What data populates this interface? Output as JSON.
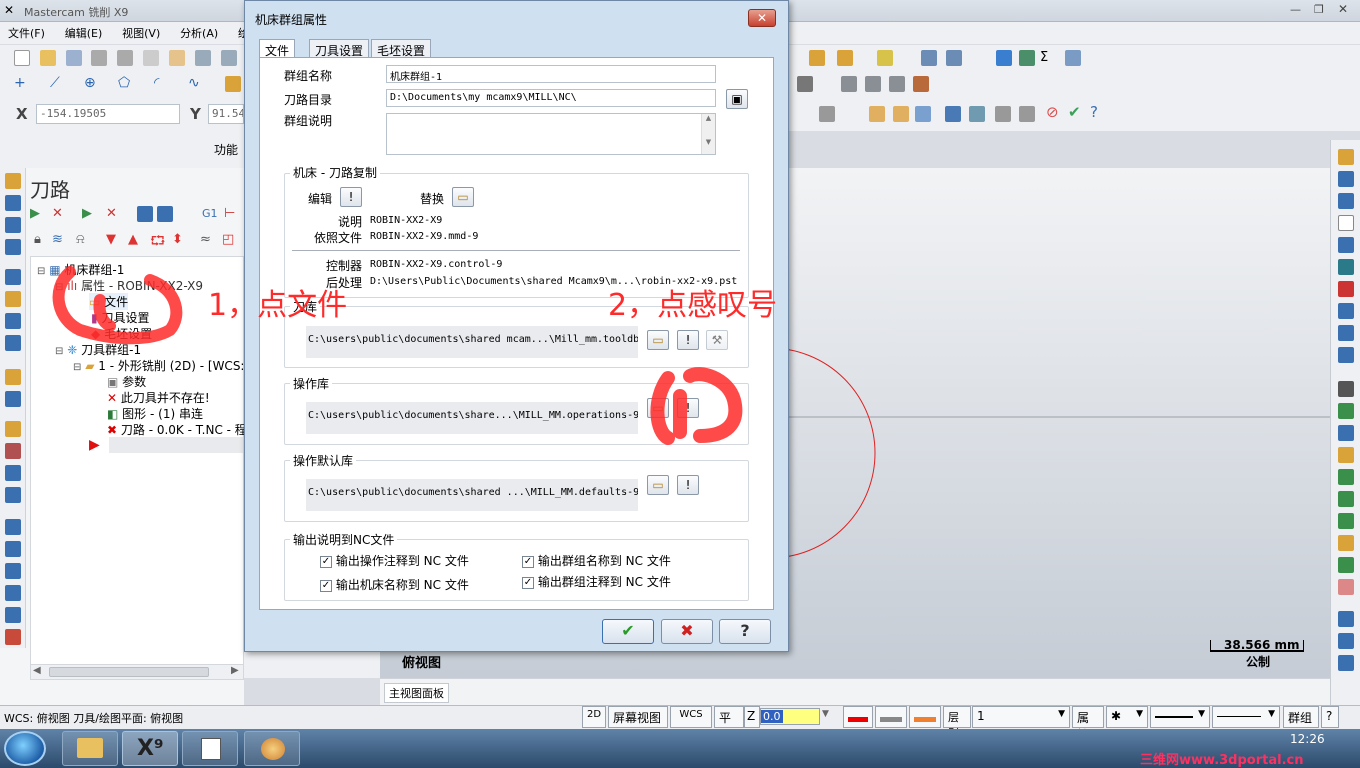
{
  "app": {
    "title": "Mastercam 铣削 X9"
  },
  "menu": [
    "文件(F)",
    "编辑(E)",
    "视图(V)",
    "分析(A)",
    "绘图"
  ],
  "coords": {
    "x_label": "X",
    "x_value": "-154.19505",
    "y_label": "Y",
    "y_value": "91.54"
  },
  "toolbar": {
    "func_label": "功能"
  },
  "panel": {
    "title": "刀路",
    "tree": [
      "机床群组-1",
      "属性 - ROBIN-XX2-X9",
      "文件",
      "刀具设置",
      "毛坯设置",
      "刀具群组-1",
      "1 - 外形铣削 (2D) - [WCS:",
      "参数",
      "此刀具并不存在!",
      "图形 - (1) 串连",
      "刀路 - 0.0K - T.NC - 程"
    ]
  },
  "dialog": {
    "title": "机床群组属性",
    "tabs": [
      "文件",
      "刀具设置",
      "毛坯设置"
    ],
    "group_name_label": "群组名称",
    "group_name_value": "机床群组-1",
    "toolpath_dir_label": "刀路目录",
    "toolpath_dir_value": "D:\\Documents\\my mcamx9\\MILL\\NC\\",
    "group_desc_label": "群组说明",
    "machine_group_title": "机床 - 刀路复制",
    "edit_label": "编辑",
    "replace_label": "替换",
    "desc_label": "说明",
    "desc_value": "ROBIN-XX2-X9",
    "ref_label": "依照文件",
    "ref_value": "ROBIN-XX2-X9.mmd-9",
    "controller_label": "控制器",
    "controller_value": "ROBIN-XX2-X9.control-9",
    "post_label": "后处理",
    "post_value": "D:\\Users\\Public\\Documents\\shared Mcamx9\\m...\\robin-xx2-x9.pst",
    "tool_lib_title": "刀库",
    "tool_lib_path": "C:\\users\\public\\documents\\shared mcam...\\Mill_mm.tooldb",
    "op_lib_title": "操作库",
    "op_lib_path": "C:\\users\\public\\documents\\share...\\MILL_MM.operations-9",
    "op_default_title": "操作默认库",
    "op_default_path": "C:\\users\\public\\documents\\shared ...\\MILL_MM.defaults-9",
    "nc_title": "输出说明到NC文件",
    "chk1": "输出操作注释到 NC 文件",
    "chk2": "输出群组名称到 NC 文件",
    "chk3": "输出机床名称到 NC 文件",
    "chk4": "输出群组注释到 NC 文件"
  },
  "annotations": {
    "step1": "1，点文件",
    "step2": "2，点感叹号"
  },
  "viewport": {
    "view_label": "俯视图",
    "scale_value": "38.566 mm",
    "scale_unit": "公制",
    "panel_tab": "主视图面板"
  },
  "status": {
    "wcs_text": "WCS: 俯视图  刀具/绘图平面: 俯视图",
    "mode_2d": "2D",
    "screen_view": "屏幕视图",
    "wcs": "WCS",
    "plane": "平面",
    "z_label": "Z",
    "z_value": "0.0",
    "layer_label": "层别",
    "layer_value": "1",
    "attr": "属性",
    "group": "群组",
    "help": "?"
  },
  "taskbar": {
    "time": "12:26",
    "watermark": "三维网www.3dportal.cn"
  },
  "colors": {
    "accent": "#ff2a2a",
    "dialog": "#cfe0f1"
  }
}
